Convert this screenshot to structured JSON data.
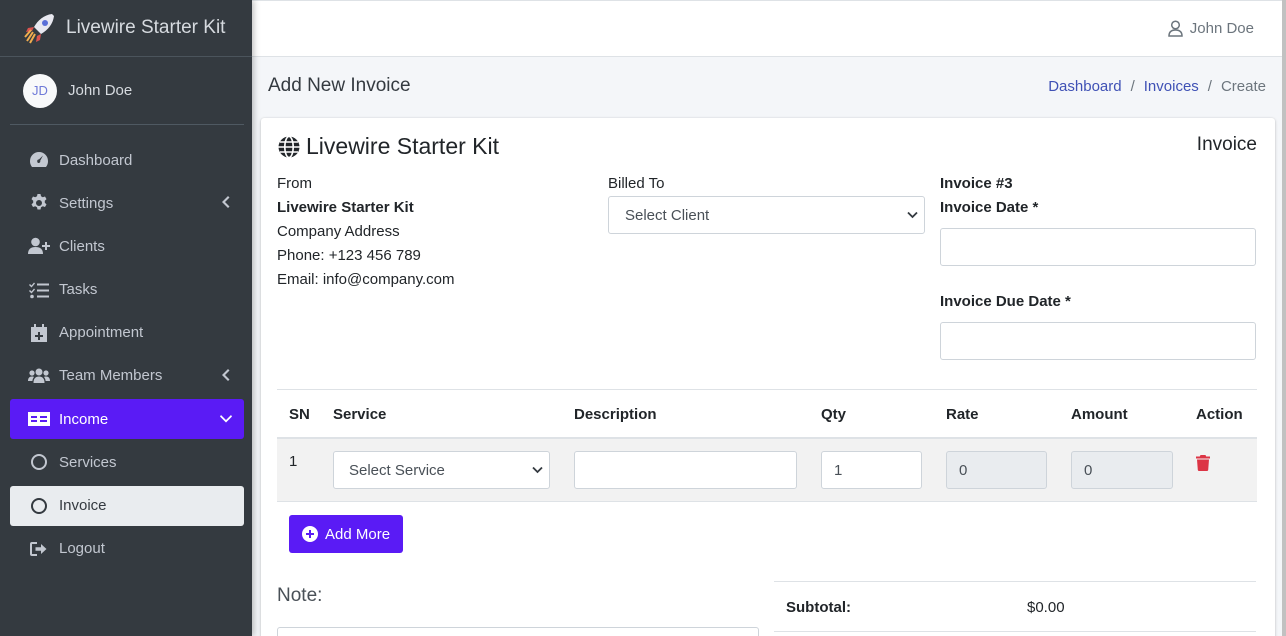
{
  "app": {
    "brand": "Livewire Starter Kit",
    "user_initials": "JD",
    "user_name": "John Doe"
  },
  "sidebar": {
    "items": [
      {
        "label": "Dashboard"
      },
      {
        "label": "Settings"
      },
      {
        "label": "Clients"
      },
      {
        "label": "Tasks"
      },
      {
        "label": "Appointment"
      },
      {
        "label": "Team Members"
      },
      {
        "label": "Income"
      },
      {
        "label": "Services"
      },
      {
        "label": "Invoice"
      },
      {
        "label": "Logout"
      }
    ]
  },
  "topbar": {
    "user_name": "John Doe"
  },
  "header": {
    "title": "Add New Invoice",
    "breadcrumb": [
      "Dashboard",
      "Invoices",
      "Create"
    ],
    "breadcrumb_sep": "/"
  },
  "invoice": {
    "company_title": "Livewire Starter Kit",
    "doc_label": "Invoice",
    "from": {
      "label": "From",
      "company": "Livewire Starter Kit",
      "address": "Company Address",
      "phone": "Phone: +123 456 789",
      "email": "Email: info@company.com"
    },
    "billed_to": {
      "label": "Billed To",
      "selected": "Select Client"
    },
    "number": "Invoice #3",
    "date_label": "Invoice Date *",
    "due_date_label": "Invoice Due Date *",
    "date_value": "",
    "due_date_value": ""
  },
  "table": {
    "headers": [
      "SN",
      "Service",
      "Description",
      "Qty",
      "Rate",
      "Amount",
      "Action"
    ],
    "rows": [
      {
        "sn": "1",
        "service": "Select Service",
        "description": "",
        "qty": "1",
        "rate": "0",
        "amount": "0"
      }
    ],
    "add_more_label": "Add More"
  },
  "footer": {
    "note_label": "Note:",
    "subtotal_label": "Subtotal:",
    "subtotal_value": "$0.00"
  },
  "colors": {
    "sidebar_bg": "#343a40",
    "accent": "#5a1bf5",
    "link": "#3f51b5",
    "danger": "#dc3545"
  }
}
